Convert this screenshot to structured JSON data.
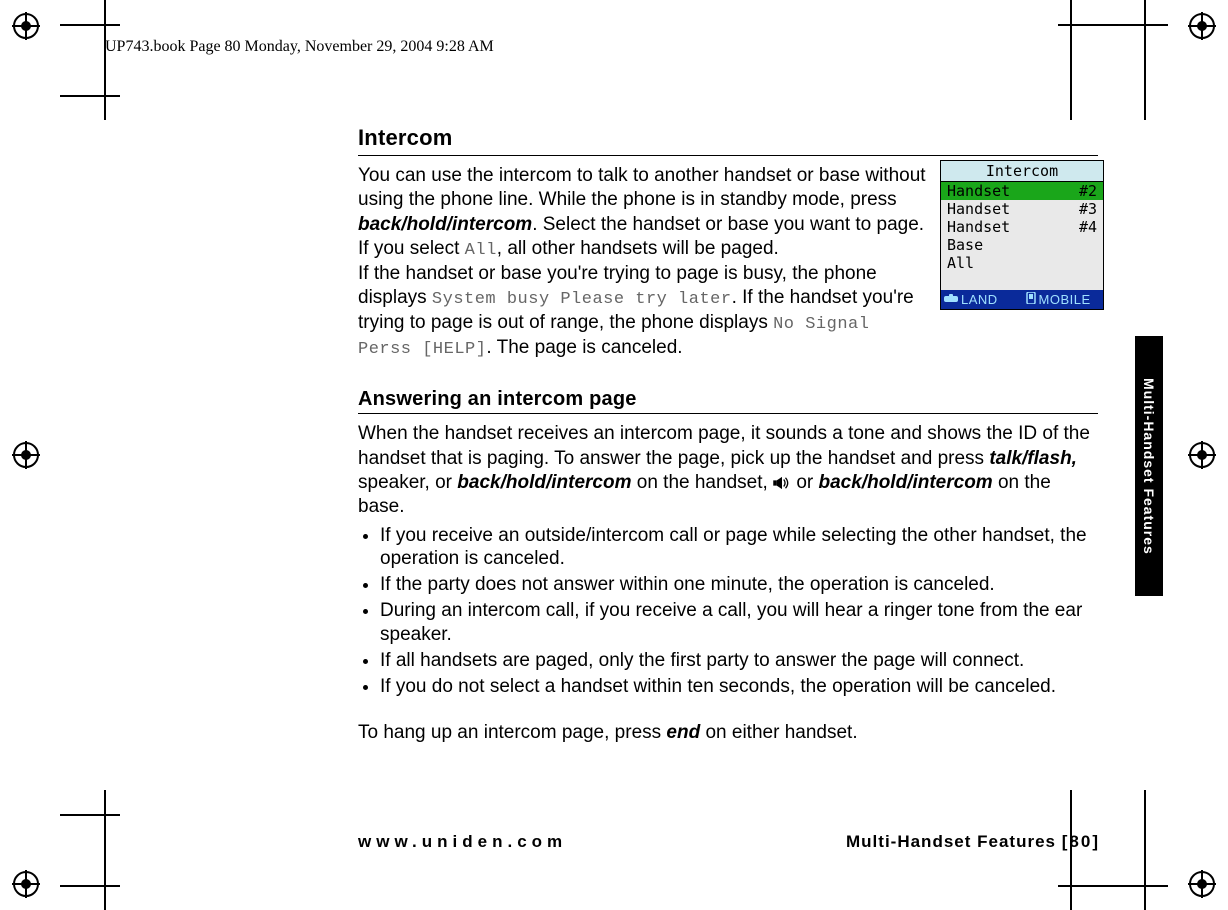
{
  "header": {
    "stamp": "UP743.book  Page 80  Monday, November 29, 2004  9:28 AM"
  },
  "sidebar": {
    "tab_label": "Multi-Handset Features"
  },
  "footer": {
    "url": "www.uniden.com",
    "section": "Multi-Handset Features",
    "page_open": "[",
    "page_num": "80",
    "page_close": "]"
  },
  "section1": {
    "title": "Intercom",
    "p1a": "You can use the intercom to talk to another handset or base without using the phone line. While the phone is in standby mode, press ",
    "key1": "back/hold/intercom",
    "p1b": ". Select the handset or base you want to page. If you select ",
    "mono_all": "All",
    "p1c": ", all other handsets will be paged.",
    "p2a": "If the handset or base you're trying to page is busy, the phone displays ",
    "mono_busy": "System busy Please try later",
    "p2b": ". If the handset you're trying to page is out of range, the phone displays ",
    "mono_nosig": "No Signal Perss [HELP]",
    "p2c": ". The page is canceled."
  },
  "section2": {
    "title": "Answering an intercom page",
    "p1a": "When the handset receives an intercom page, it sounds a tone and shows the ID of the handset that is paging. To answer the page, pick up the handset and press ",
    "key_talk": "talk/flash,",
    "p1b": " speaker, or ",
    "key_bhi1": "back/hold/intercom",
    "p1c": " on the handset, ",
    "speaker_icon": "speaker-icon",
    "p1d": " or ",
    "key_bhi2": "back/hold/intercom",
    "p1e": " on the base.",
    "bullets": [
      "If you receive an outside/intercom call or page while selecting the other handset, the operation is canceled.",
      "If the party does not answer within one minute, the operation is canceled.",
      "During an intercom call, if you receive a call, you will hear a ringer tone from the ear speaker.",
      "If all handsets are paged, only the first party to answer the page will connect.",
      "If you do not select a handset within ten seconds, the operation will be canceled."
    ],
    "p_end_a": "To hang up an intercom page, press ",
    "key_end": "end",
    "p_end_b": " on either handset."
  },
  "phone_screen": {
    "title": "Intercom",
    "rows": [
      {
        "label": "Handset",
        "num": "#2",
        "selected": true
      },
      {
        "label": "Handset",
        "num": "#3",
        "selected": false
      },
      {
        "label": "Handset",
        "num": "#4",
        "selected": false
      },
      {
        "label": "Base",
        "num": "",
        "selected": false
      },
      {
        "label": "All",
        "num": "",
        "selected": false
      }
    ],
    "softkeys": {
      "left": "LAND",
      "right": "MOBILE"
    }
  }
}
